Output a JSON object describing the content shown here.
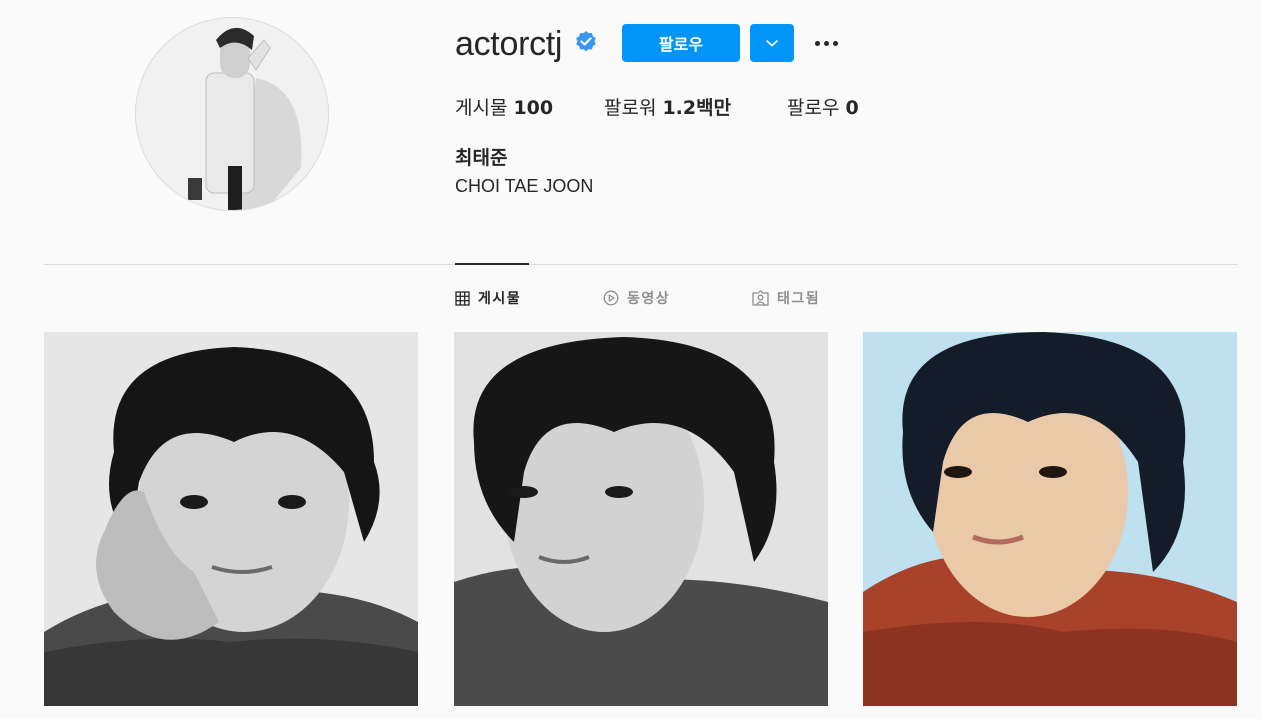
{
  "profile": {
    "username": "actorctj",
    "follow_label": "팔로우",
    "stats": {
      "posts_label": "게시물",
      "posts_value": "100",
      "followers_label": "팔로워",
      "followers_value": "1.2백만",
      "following_label": "팔로우",
      "following_value": "0"
    },
    "full_name": "최태준",
    "bio": "CHOI TAE JOON"
  },
  "tabs": [
    {
      "label": "게시물",
      "icon": "grid-icon",
      "active": true
    },
    {
      "label": "동영상",
      "icon": "play-circle-icon",
      "active": false
    },
    {
      "label": "태그됨",
      "icon": "tagged-user-icon",
      "active": false
    }
  ],
  "colors": {
    "accent": "#0095f6",
    "background": "#fafafa",
    "divider": "#dbdbdb",
    "text": "#262626",
    "muted": "#8e8e8e"
  },
  "icons": {
    "verified": "verified-badge-icon",
    "dropdown": "chevron-down-icon",
    "more": "more-options-icon"
  }
}
